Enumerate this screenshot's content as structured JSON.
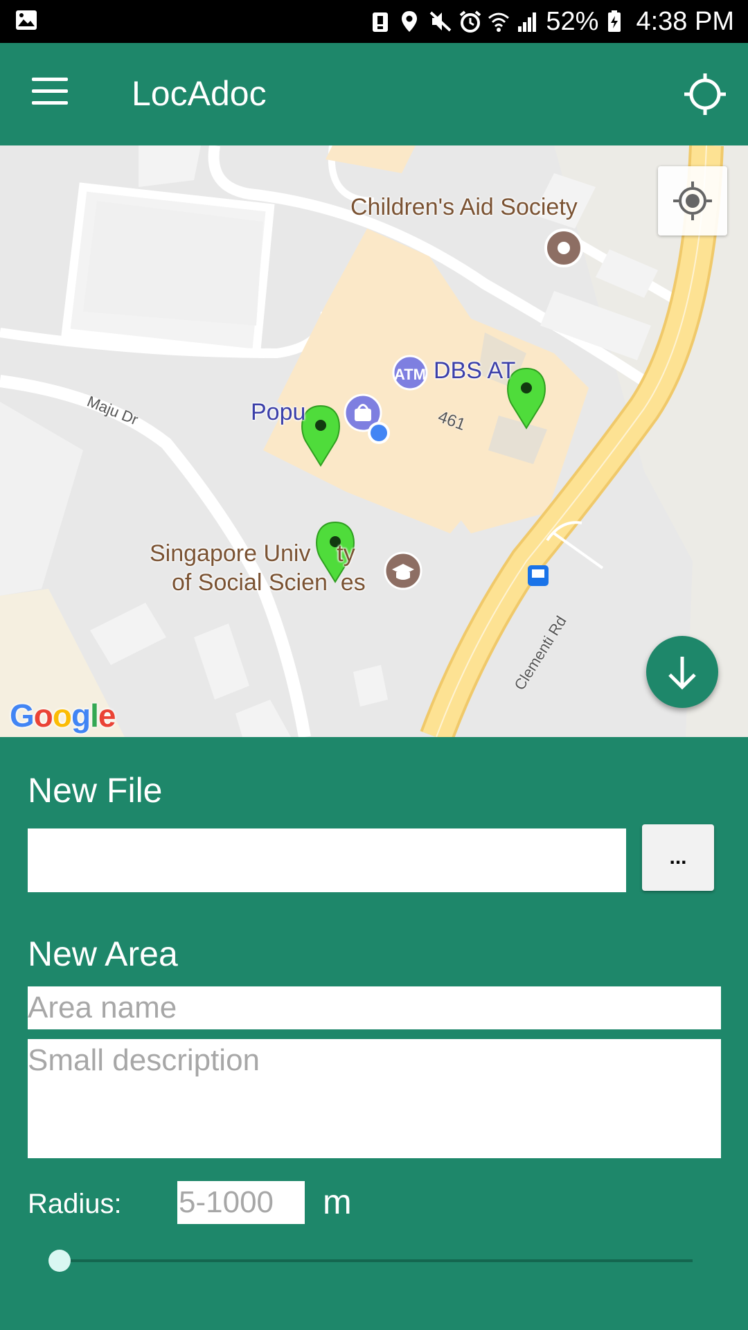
{
  "status_bar": {
    "battery": "52%",
    "time": "4:38 PM",
    "icons": [
      "image-icon",
      "alert-icon",
      "location-icon",
      "mute-icon",
      "alarm-icon",
      "wifi-icon",
      "signal-icon",
      "battery-icon"
    ]
  },
  "app_bar": {
    "title": "LocAdoc",
    "menu_icon": "hamburger-icon",
    "action_icon": "crosshair-icon"
  },
  "map": {
    "labels": {
      "childrens_aid": "Children's Aid Society",
      "dbs_atm": "DBS AT",
      "atm_badge": "ATM",
      "popular": "Popu",
      "suss_line1": "Singapore Univ    ty",
      "suss_line2": "of Social Scien  es",
      "building_no": "461",
      "maju_dr": "Maju Dr",
      "clementi_rd": "Clementi Rd"
    },
    "logo": "Google",
    "markers_count": 3,
    "colors": {
      "marker": "#4fdc3b",
      "road_major": "#fde293",
      "building_area": "#fbe8c8",
      "poi_brown": "#8d6e63",
      "poi_blue": "#7e7fe0",
      "my_location": "#4285f4"
    }
  },
  "form": {
    "new_file_heading": "New File",
    "file_value": "",
    "browse_label": "...",
    "new_area_heading": "New Area",
    "area_name_placeholder": "Area name",
    "description_placeholder": "Small description",
    "radius_label": "Radius:",
    "radius_placeholder": "5-1000",
    "radius_unit": "m",
    "slider_value": 0
  },
  "colors": {
    "primary": "#1e876a",
    "slider_thumb": "#d9f7f2"
  }
}
